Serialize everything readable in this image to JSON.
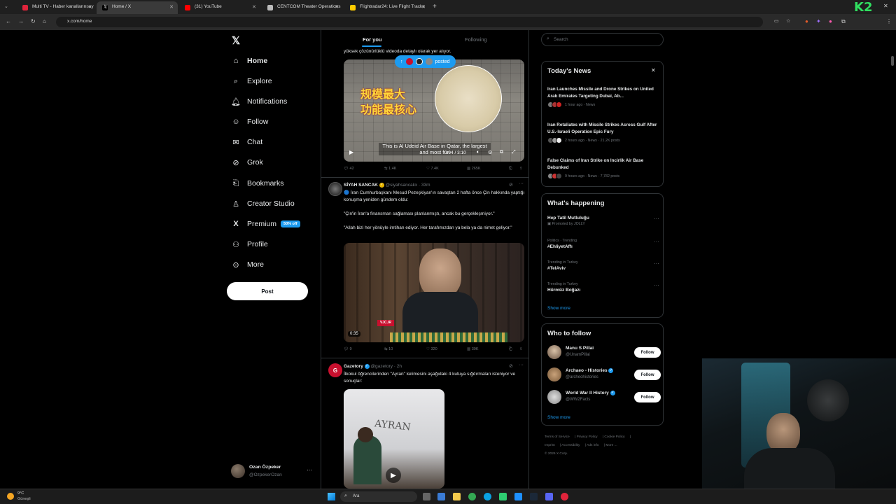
{
  "browser": {
    "tabs": [
      {
        "label": "Multi TV - Haber kanallarını ay",
        "color": "#e0243b"
      },
      {
        "label": "Home / X",
        "color": "#ffffff"
      },
      {
        "label": "(31) YouTube",
        "color": "#ff0000"
      },
      {
        "label": "CENTCOM Theater Operations",
        "color": "#bbbbbb"
      },
      {
        "label": "Flightradar24: Live Flight Tracke",
        "color": "#ffcc00"
      }
    ],
    "url": "x.com/home",
    "brand_mark": "K2"
  },
  "sidebar": {
    "items": [
      {
        "label": "Home",
        "icon": "home-icon",
        "glyph": "⌂"
      },
      {
        "label": "Explore",
        "icon": "search-icon",
        "glyph": "⌕"
      },
      {
        "label": "Notifications",
        "icon": "bell-icon",
        "glyph": "♫"
      },
      {
        "label": "Follow",
        "icon": "person-add-icon",
        "glyph": "☺"
      },
      {
        "label": "Chat",
        "icon": "mail-icon",
        "glyph": "✉"
      },
      {
        "label": "Grok",
        "icon": "grok-icon",
        "glyph": "⊘"
      },
      {
        "label": "Bookmarks",
        "icon": "bookmark-icon",
        "glyph": "⚑"
      },
      {
        "label": "Creator Studio",
        "icon": "creator-icon",
        "glyph": "♙"
      },
      {
        "label": "Premium",
        "icon": "x-icon",
        "glyph": "X"
      },
      {
        "label": "Profile",
        "icon": "profile-icon",
        "glyph": "☻"
      },
      {
        "label": "More",
        "icon": "more-circle-icon",
        "glyph": "⊙"
      }
    ],
    "premium_badge": "50% off",
    "post_label": "Post",
    "profile": {
      "name": "Ozan Özpeker",
      "handle": "@OzpekerOzan"
    }
  },
  "feed": {
    "tabs": {
      "for_you": "For you",
      "following": "Following"
    },
    "posted_pill": "posted",
    "tweet1": {
      "text_tail": "yüksek çözünürlüklü videoda detaylı olarak yer alıyor.",
      "video_overlay_cn_1": "规模最大",
      "video_overlay_cn_2": "功能最核心",
      "caption": "This is Al Udeid Air Base in Qatar, the largest and most fun",
      "time": "0:04 / 3:10",
      "replies": "42",
      "reposts": "1.4K",
      "likes": "7.4K",
      "views": "265K"
    },
    "tweet2": {
      "name": "SİYAH SANCAK",
      "handle": "@siyahsancakx",
      "time": "33m",
      "text1": "🔵 İran Cumhurbaşkanı Mesud Pezeşkiyan'ın savaştan 2 hafta önce Çin hakkında yaptığı konuşma yeniden gündem oldu:",
      "text2": "\"Çin'in İran'a finansman sağlaması planlanmıştı, ancak bu gerçekleşmiyor.\"",
      "text3": "\"Allah bizi her yönüyle imtihan ediyor. Her tarafımızdan ya bela ya da nimet geliyor.\"",
      "video_time": "0:35",
      "replies": "9",
      "reposts": "10",
      "likes": "320",
      "views": "39K"
    },
    "tweet3": {
      "name": "Gazetory",
      "handle": "@gazetory",
      "time": "2h",
      "text": "İlkokul öğrencilerinden \"Ayran\" kelimesini aşağıdaki 4 kutuya sığdırmaları isteniyor ve sonuçlar:",
      "board_word": "AYRAN"
    }
  },
  "right": {
    "search_placeholder": "Search",
    "news_title": "Today's News",
    "news": [
      {
        "title": "Iran Launches Missile and Drone Strikes on United Arab Emirates Targeting Dubai, Ab...",
        "meta": "1 hour ago · News"
      },
      {
        "title": "Iran Retaliates with Missile Strikes Across Gulf After U.S.-Israeli Operation Epic Fury",
        "meta": "2 hours ago · News · 21.2K posts"
      },
      {
        "title": "False Claims of Iran Strike on Incirlik Air Base Debunked",
        "meta": "9 hours ago · News · 7,782 posts"
      }
    ],
    "happening_title": "What's happening",
    "trends": [
      {
        "category": "",
        "title": "Hep Tatil Mutluluğu",
        "sub": "Promoted by JOLLY"
      },
      {
        "category": "Politics · Trending",
        "title": "#EhliyetAffı",
        "sub": ""
      },
      {
        "category": "Trending in Turkey",
        "title": "#TelAviv",
        "sub": ""
      },
      {
        "category": "Trending in Turkey",
        "title": "Hürmüz Boğazı",
        "sub": ""
      }
    ],
    "show_more": "Show more",
    "wtf_title": "Who to follow",
    "who_to_follow": [
      {
        "name": "Manu S Pillai",
        "handle": "@UnamPillai",
        "verified": false
      },
      {
        "name": "Archaeo - Histories",
        "handle": "@archeohistories",
        "verified": true
      },
      {
        "name": "World War II History",
        "handle": "@WW2Facts",
        "verified": true
      }
    ],
    "follow_label": "Follow",
    "footer": [
      "Terms of Service",
      "Privacy Policy",
      "Cookie Policy",
      "Imprint",
      "Accessibility",
      "Ads info",
      "More ...",
      "© 2026 X Corp."
    ]
  },
  "taskbar": {
    "weather_temp": "9°C",
    "weather_desc": "Güneşli",
    "search_placeholder": "Ara"
  }
}
